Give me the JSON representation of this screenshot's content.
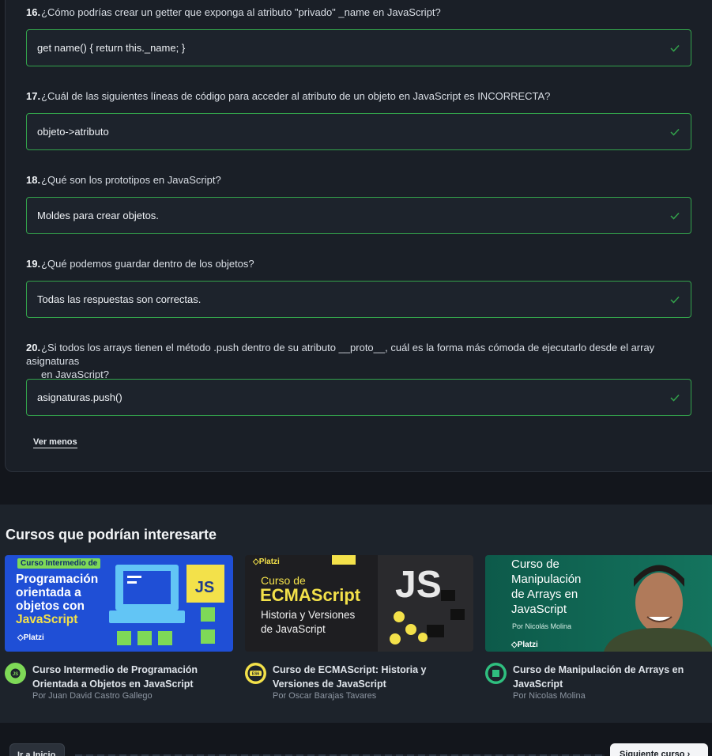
{
  "quiz": {
    "questions": [
      {
        "num": "16.",
        "text": "¿Cómo podrías crear un getter que exponga al atributo \"privado\" _name en JavaScript?",
        "text2": "",
        "answer": "get name() { return this._name; }"
      },
      {
        "num": "17.",
        "text": "¿Cuál de las siguientes líneas de código para acceder al atributo de un objeto en JavaScript es INCORRECTA?",
        "text2": "",
        "answer": "objeto->atributo"
      },
      {
        "num": "18.",
        "text": "¿Qué son los prototipos en JavaScript?",
        "text2": "",
        "answer": "Moldes para crear objetos."
      },
      {
        "num": "19.",
        "text": "¿Qué podemos guardar dentro de los objetos?",
        "text2": "",
        "answer": "Todas las respuestas son correctas."
      },
      {
        "num": "20.",
        "text": "¿Si todos los arrays tienen el método .push dentro de su atributo __proto__, cuál es la forma más cómoda de ejecutarlo desde el array asignaturas",
        "text2": "en JavaScript?",
        "answer": "asignaturas.push()"
      }
    ],
    "ver_menos": "Ver menos",
    "correct_color": "#33a24b"
  },
  "courses": {
    "heading": "Cursos que podrían interesarte",
    "cards": [
      {
        "thumb": {
          "badge": "Curso Intermedio de",
          "title_l1": "Programación",
          "title_l2": "orientada a",
          "title_l3": "objetos con",
          "title_l4": "JavaScript",
          "brand": "Platzi",
          "js": "JS"
        },
        "title": "Curso Intermedio de Programación Orientada a Objetos en JavaScript",
        "author": "Por Juan David Castro Gallego",
        "icon": "js-badge-icon"
      },
      {
        "thumb": {
          "brand": "Platzi",
          "title_l1": "Curso de",
          "title_l2": "ECMAScript",
          "title_l3": "Historia y Versiones",
          "title_l4": "de JavaScript",
          "js": "JS"
        },
        "title": "Curso de ECMAScript: Historia y Versiones de JavaScript",
        "author": "Por Oscar Barajas Tavares",
        "icon": "es6-badge-icon"
      },
      {
        "thumb": {
          "title_l1": "Curso de",
          "title_l2": "Manipulación",
          "title_l3": "de Arrays en",
          "title_l4": "JavaScript",
          "author": "Por Nicolás Molina",
          "brand": "Platzi"
        },
        "title": "Curso de Manipulación de Arrays en JavaScript",
        "author": "Por Nicolas Molina",
        "icon": "arrays-badge-icon"
      }
    ]
  },
  "footer": {
    "prev": "Ir a Inicio",
    "next": "Siguiente curso"
  }
}
